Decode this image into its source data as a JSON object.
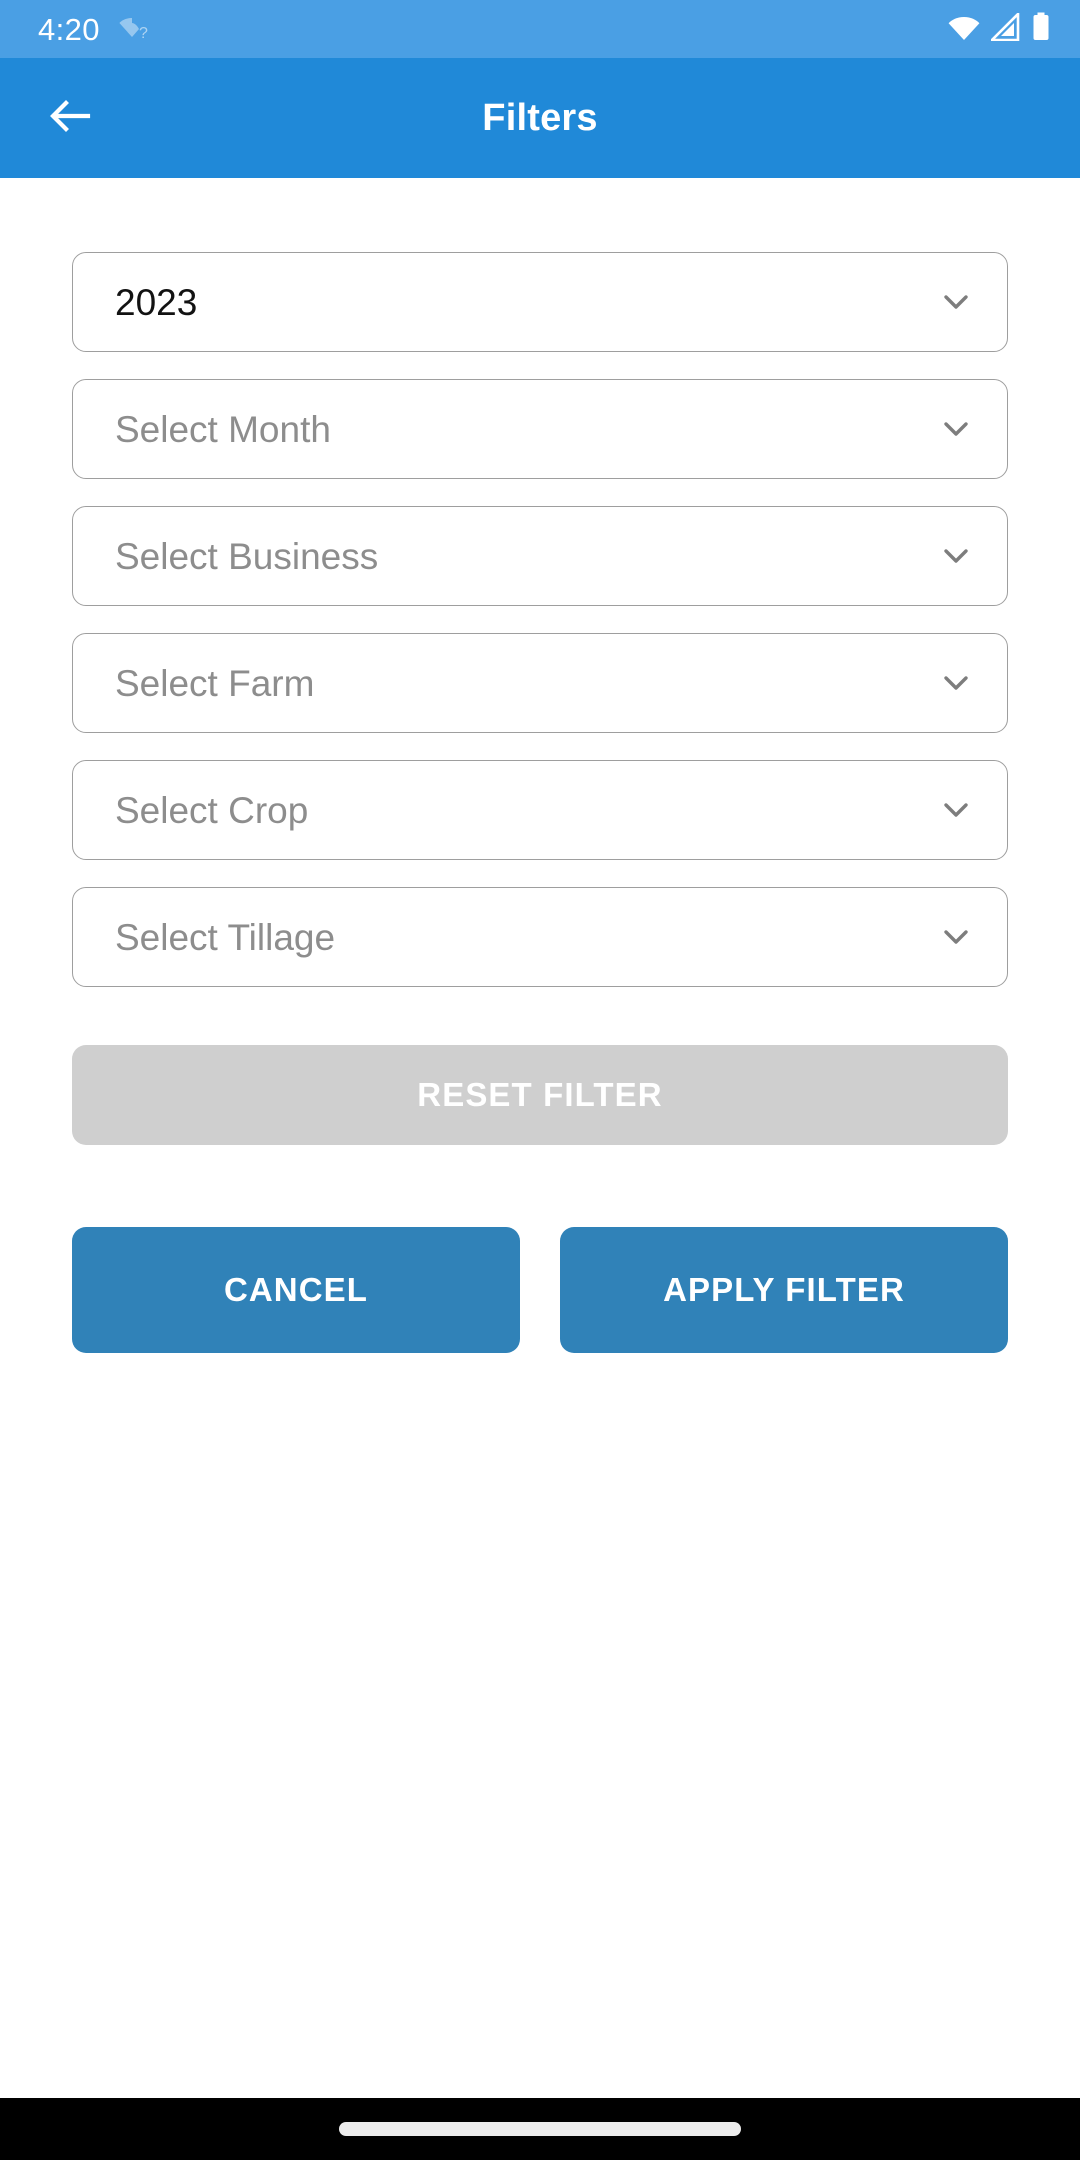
{
  "status_bar": {
    "time": "4:20",
    "wifi_unknown_icon": "wifi-question-icon",
    "wifi_icon": "wifi-icon",
    "signal_icon": "cell-signal-icon",
    "battery_icon": "battery-icon",
    "background_color": "#4a9fe4"
  },
  "app_bar": {
    "title": "Filters",
    "back_icon": "arrow-left-icon",
    "background_color": "#2089d8",
    "text_color": "#ffffff"
  },
  "filters": {
    "fields": [
      {
        "name": "year",
        "text": "2023",
        "is_placeholder": false,
        "chevron": "chevron-down-icon"
      },
      {
        "name": "month",
        "text": "Select Month",
        "is_placeholder": true,
        "chevron": "chevron-down-icon"
      },
      {
        "name": "business",
        "text": "Select Business",
        "is_placeholder": true,
        "chevron": "chevron-down-icon"
      },
      {
        "name": "farm",
        "text": "Select Farm",
        "is_placeholder": true,
        "chevron": "chevron-down-icon"
      },
      {
        "name": "crop",
        "text": "Select Crop",
        "is_placeholder": true,
        "chevron": "chevron-down-icon"
      },
      {
        "name": "tillage",
        "text": "Select Tillage",
        "is_placeholder": true,
        "chevron": "chevron-down-icon"
      }
    ]
  },
  "actions": {
    "reset_label": "RESET FILTER",
    "reset_enabled": false,
    "reset_background": "#cfcfcf",
    "cancel_label": "CANCEL",
    "apply_label": "APPLY FILTER",
    "primary_button_color": "#3082b8"
  },
  "nav_bar": {
    "gesture_pill": "home-gesture-pill",
    "background_color": "#000000"
  }
}
